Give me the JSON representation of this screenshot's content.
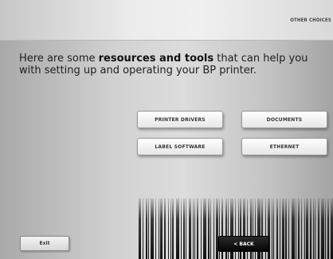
{
  "header": {
    "other_choices_label": "OTHER CHOICES"
  },
  "intro": {
    "text_before": "Here are some ",
    "text_bold": "resources and tools",
    "text_after": " that can help you with setting up and operating your BP printer."
  },
  "resources": {
    "printer_drivers": "PRINTER DRIVERS",
    "documents": "DOCUMENTS",
    "label_software": "LABEL SOFTWARE",
    "ethernet": "ETHERNET"
  },
  "footer": {
    "exit_label": "Exit",
    "back_label": "< BACK"
  }
}
